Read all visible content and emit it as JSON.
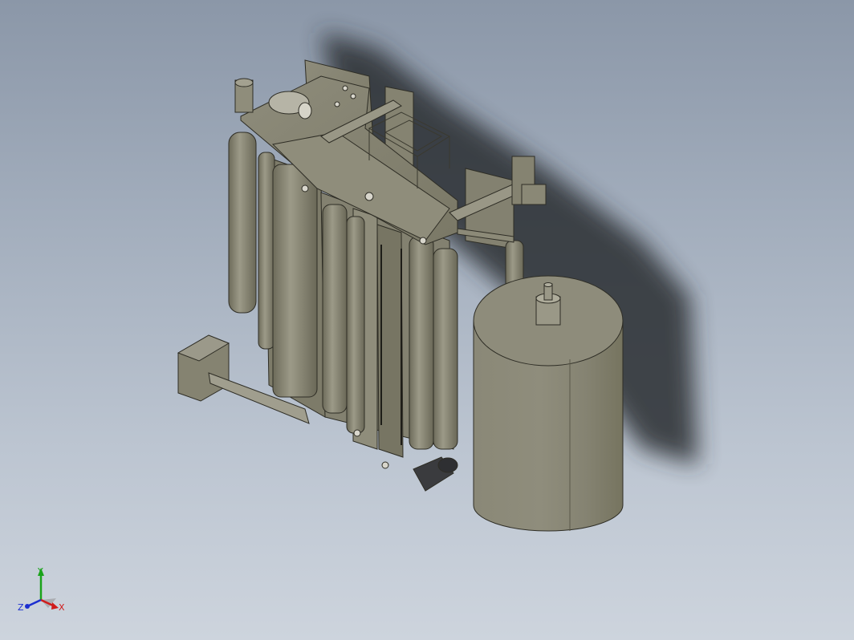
{
  "viewport": {
    "background_top": "#8b97a8",
    "background_bottom": "#cdd4dd",
    "model_color": "#8c8a78",
    "shadow_color": "#2a2c30"
  },
  "triad": {
    "x_label": "X",
    "y_label": "Y",
    "z_label": "Z",
    "x_color": "#d01c1c",
    "y_color": "#1aa31a",
    "z_color": "#1c2fd0"
  }
}
